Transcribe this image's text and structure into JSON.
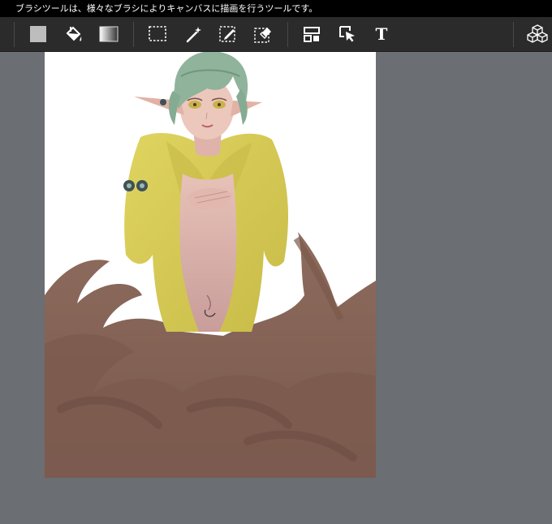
{
  "status": {
    "hint_text": "ブラシツールは、様々なブラシによりキャンバスに描画を行うツールです。"
  },
  "toolbar": {
    "tools": [
      {
        "id": "fill-color",
        "icon": "square-swatch-icon"
      },
      {
        "id": "bucket",
        "icon": "paint-bucket-icon"
      },
      {
        "id": "gradient",
        "icon": "gradient-icon"
      },
      {
        "id": "select-rect",
        "icon": "marquee-select-icon"
      },
      {
        "id": "magic-wand",
        "icon": "magic-wand-icon"
      },
      {
        "id": "select-pen",
        "icon": "selection-pen-icon"
      },
      {
        "id": "select-eraser",
        "icon": "selection-eraser-icon"
      },
      {
        "id": "layout",
        "icon": "layout-icon"
      },
      {
        "id": "move",
        "icon": "operation-arrow-icon"
      },
      {
        "id": "text",
        "icon": "text-icon",
        "label": "T"
      },
      {
        "id": "3d",
        "icon": "cubes-icon"
      }
    ]
  },
  "colors": {
    "status_bg": "#000000",
    "toolbar_bg": "#2b2b2b",
    "workspace_bg": "#6b6e72",
    "canvas_bg": "#ffffff",
    "hair": "#8fb39b",
    "coat": "#d8cc55",
    "tail": "#8a6a5a"
  }
}
